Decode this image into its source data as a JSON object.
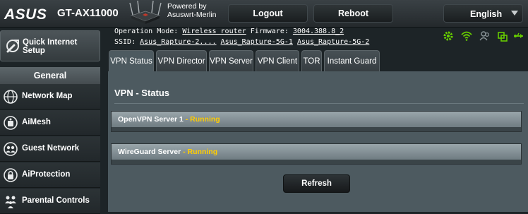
{
  "header": {
    "logo": "ASUS",
    "model": "GT-AX11000",
    "powered_by": "Powered by",
    "firmware_brand": "Asuswrt-Merlin",
    "logout_label": "Logout",
    "reboot_label": "Reboot",
    "language": "English"
  },
  "sidebar": {
    "quick_setup_line1": "Quick Internet",
    "quick_setup_line2": "Setup",
    "section_title": "General",
    "items": [
      {
        "label": "Network Map",
        "icon": "network-map-icon"
      },
      {
        "label": "AiMesh",
        "icon": "aimesh-icon"
      },
      {
        "label": "Guest Network",
        "icon": "guest-network-icon"
      },
      {
        "label": "AiProtection",
        "icon": "aiprotection-icon"
      },
      {
        "label": "Parental Controls",
        "icon": "parental-controls-icon"
      }
    ]
  },
  "status": {
    "op_mode_label": "Operation Mode:",
    "op_mode_value": "Wireless router",
    "firmware_label": "Firmware:",
    "firmware_value": "3004.388.8_2",
    "ssid_label": "SSID:",
    "ssid_values": [
      "Asus_Rapture-2....",
      "Asus_Rapture-5G-1",
      "Asus_Rapture-5G-2"
    ],
    "indicator_icons": [
      "gear-icon",
      "wifi-icon",
      "users-icon",
      "usb-icon",
      "usb-link-icon"
    ],
    "indicator_colors": {
      "active": "#66cc00",
      "inactive": "#8a9498"
    }
  },
  "tabs": [
    {
      "label": "VPN Status",
      "active": true
    },
    {
      "label": "VPN Director",
      "active": false
    },
    {
      "label": "VPN Server",
      "active": false
    },
    {
      "label": "VPN Client",
      "active": false
    },
    {
      "label": "TOR",
      "active": false
    },
    {
      "label": "Instant Guard",
      "active": false
    }
  ],
  "main": {
    "title": "VPN - Status",
    "connections": [
      {
        "name": "OpenVPN Server 1",
        "state": " - Running"
      },
      {
        "name": "WireGuard Server",
        "state": " - Running"
      }
    ],
    "refresh_label": "Refresh",
    "running_color": "#ffcc00"
  }
}
